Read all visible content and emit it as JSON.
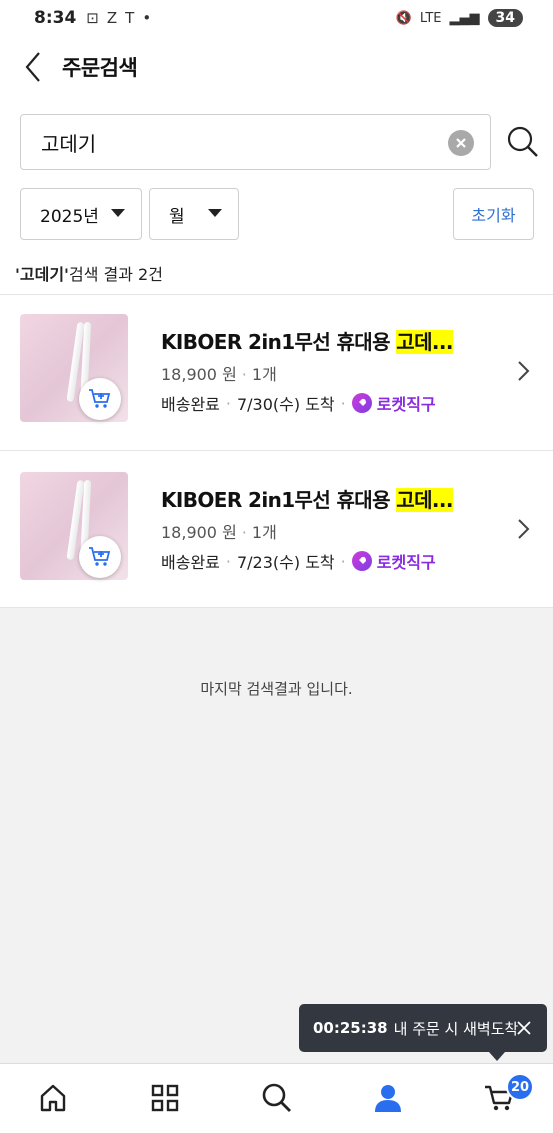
{
  "status_bar": {
    "time": "8:34",
    "network": "LTE",
    "battery": "34"
  },
  "header": {
    "title": "주문검색"
  },
  "search": {
    "query": "고데기"
  },
  "filters": {
    "year": "2025년",
    "month": "월",
    "reset_label": "초기화"
  },
  "result": {
    "keyword": "'고데기'",
    "suffix": " 검색 결과 2건"
  },
  "orders": [
    {
      "title_prefix": "KIBOER 2in1무선 휴대용 ",
      "title_highlight": "고데...",
      "price": "18,900 원",
      "quantity": "1개",
      "status": "배송완료",
      "arrival": "7/30(수) 도착",
      "badge": "로켓직구"
    },
    {
      "title_prefix": "KIBOER 2in1무선 휴대용 ",
      "title_highlight": "고데...",
      "price": "18,900 원",
      "quantity": "1개",
      "status": "배송완료",
      "arrival": "7/23(수) 도착",
      "badge": "로켓직구"
    }
  ],
  "last_message": "마지막 검색결과 입니다.",
  "toast": {
    "timer": "00:25:38",
    "text": "내 주문 시 새벽도착"
  },
  "bottom_nav": {
    "cart_count": "20"
  },
  "colors": {
    "accent": "#2f6fd1",
    "rocket": "#8a2be2",
    "highlight": "#ffff00",
    "toast_bg": "#333840",
    "badge_bg": "#2a6ef0"
  }
}
